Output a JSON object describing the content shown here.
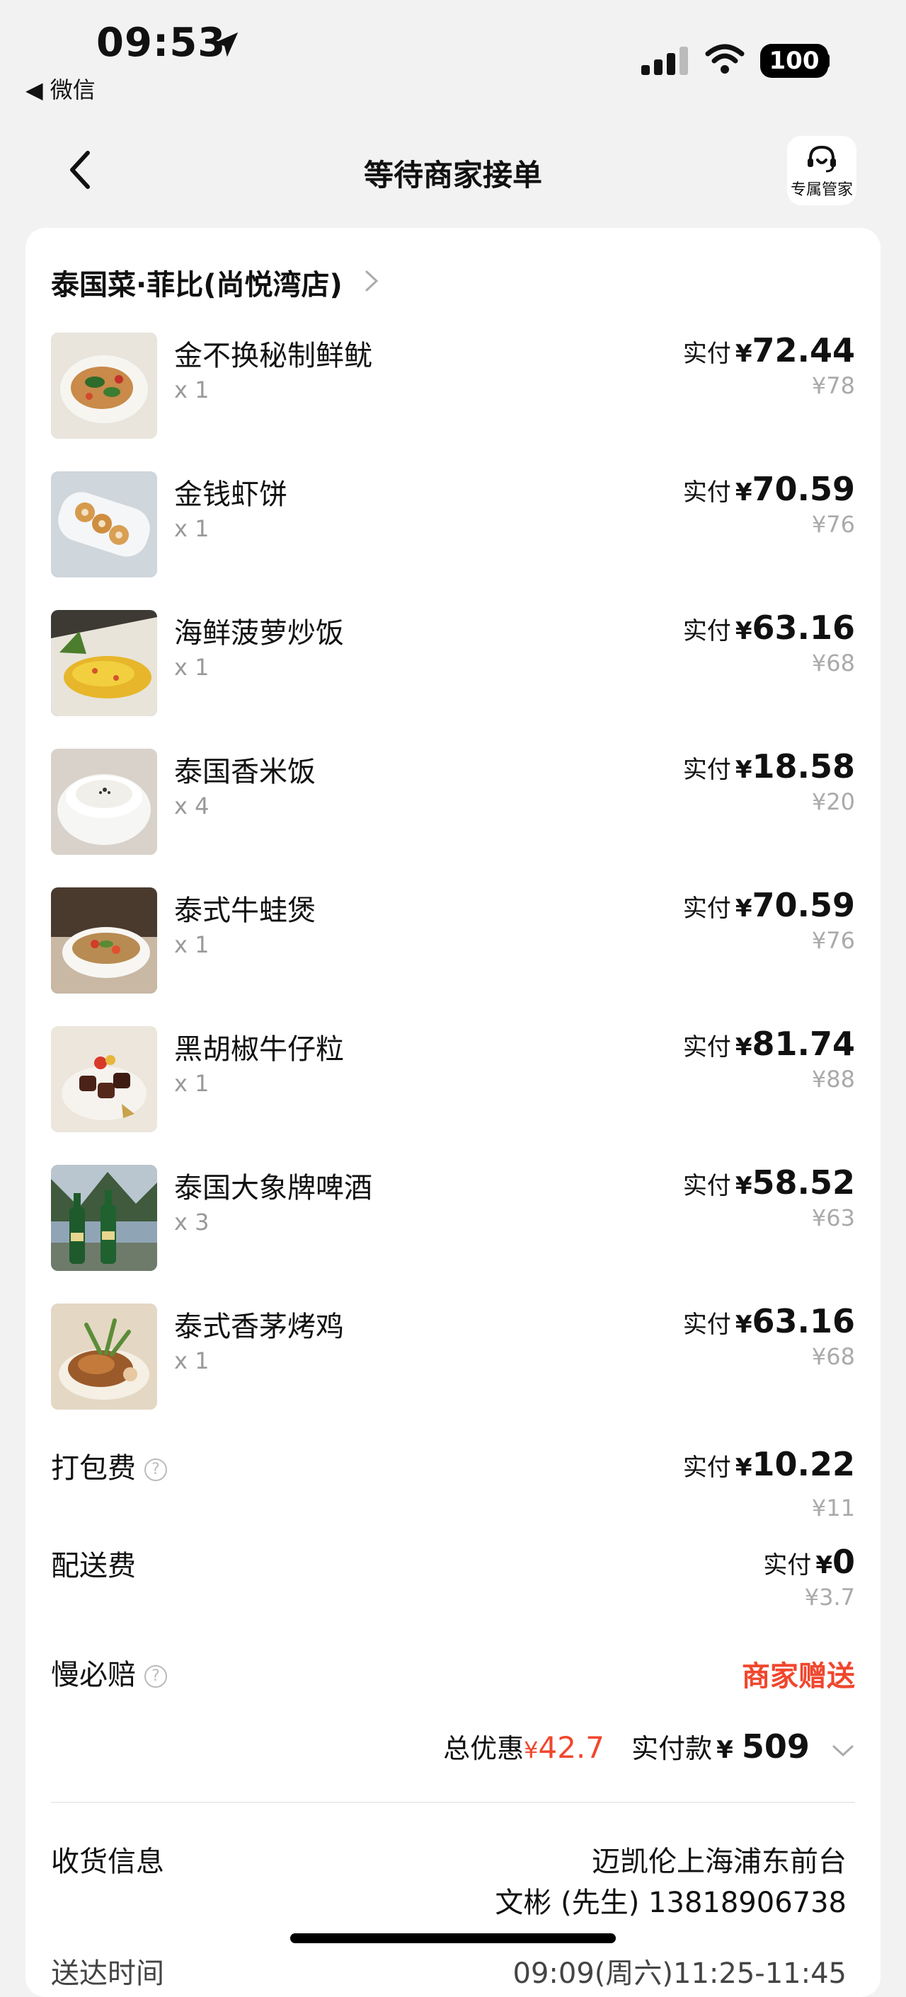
{
  "status_bar": {
    "time": "09:53",
    "back_app": "◀ 微信",
    "battery": "100"
  },
  "nav": {
    "title": "等待商家接单",
    "concierge_label": "专属管家"
  },
  "store": {
    "name": "泰国菜·菲比(尚悦湾店)"
  },
  "items": [
    {
      "name": "金不换秘制鲜鱿",
      "qty": "x 1",
      "paid_label": "实付",
      "currency": "¥",
      "paid": "72.44",
      "original": "¥78"
    },
    {
      "name": "金钱虾饼",
      "qty": "x 1",
      "paid_label": "实付",
      "currency": "¥",
      "paid": "70.59",
      "original": "¥76"
    },
    {
      "name": "海鲜菠萝炒饭",
      "qty": "x 1",
      "paid_label": "实付",
      "currency": "¥",
      "paid": "63.16",
      "original": "¥68"
    },
    {
      "name": "泰国香米饭",
      "qty": "x 4",
      "paid_label": "实付",
      "currency": "¥",
      "paid": "18.58",
      "original": "¥20"
    },
    {
      "name": "泰式牛蛙煲",
      "qty": "x 1",
      "paid_label": "实付",
      "currency": "¥",
      "paid": "70.59",
      "original": "¥76"
    },
    {
      "name": "黑胡椒牛仔粒",
      "qty": "x 1",
      "paid_label": "实付",
      "currency": "¥",
      "paid": "81.74",
      "original": "¥88"
    },
    {
      "name": "泰国大象牌啤酒",
      "qty": "x 3",
      "paid_label": "实付",
      "currency": "¥",
      "paid": "58.52",
      "original": "¥63"
    },
    {
      "name": "泰式香茅烤鸡",
      "qty": "x 1",
      "paid_label": "实付",
      "currency": "¥",
      "paid": "63.16",
      "original": "¥68"
    }
  ],
  "fees": {
    "packing": {
      "label": "打包费",
      "paid_label": "实付",
      "currency": "¥",
      "paid": "10.22",
      "original": "¥11"
    },
    "delivery": {
      "label": "配送费",
      "paid_label": "实付",
      "currency": "¥",
      "paid": "0",
      "original": "¥3.7"
    },
    "late_comp": {
      "label": "慢必赔",
      "value": "商家赠送"
    }
  },
  "totals": {
    "discount_label": "总优惠",
    "discount_currency": "¥",
    "discount": "42.7",
    "paid_label": "实付款",
    "paid_currency": "¥",
    "paid": "509"
  },
  "receiver": {
    "label": "收货信息",
    "address": "迈凯伦上海浦东前台",
    "contact": "文彬 (先生) 13818906738"
  },
  "next_row": {
    "label": "送达时间",
    "value": "09:09(周六)11:25-11:45"
  },
  "colors": {
    "accent_red": "#f0472e",
    "page_bg": "#f2f2f2",
    "card_bg": "#ffffff"
  }
}
